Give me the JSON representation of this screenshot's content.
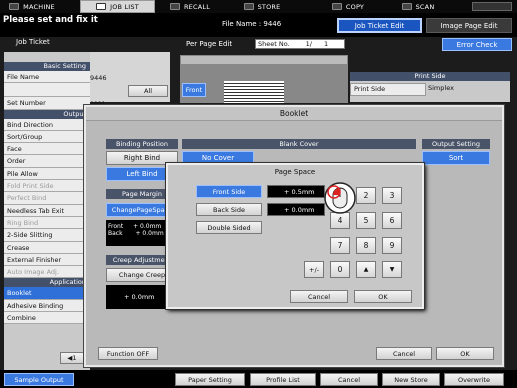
{
  "topbar": {
    "tabs": [
      {
        "label": "MACHINE",
        "active": false
      },
      {
        "label": "JOB LIST",
        "active": true
      },
      {
        "label": "RECALL",
        "active": false
      },
      {
        "label": "STORE",
        "active": false
      },
      {
        "label": "COPY",
        "active": false
      },
      {
        "label": "SCAN",
        "active": false
      }
    ]
  },
  "message": "Please set and fix it",
  "file_name_label": "File Name : 9446",
  "header_tabs": {
    "job_ticket_edit": "Job Ticket Edit",
    "image_page_edit": "Image Page Edit"
  },
  "error_check": "Error Check",
  "job_ticket": {
    "title": "Job Ticket",
    "basic_setting": "Basic Setting",
    "file_name_label": "File Name",
    "file_name_value": "9446",
    "all_button": "All",
    "set_number_label": "Set Number",
    "set_number_value": "0001",
    "output_header": "Output",
    "output_items": [
      {
        "label": "Bind Direction",
        "disabled": false
      },
      {
        "label": "Sort/Group",
        "disabled": false
      },
      {
        "label": "Face",
        "disabled": false
      },
      {
        "label": "Order",
        "disabled": false
      },
      {
        "label": "Pile Allow",
        "disabled": false
      },
      {
        "label": "Fold Print Side",
        "disabled": true
      },
      {
        "label": "Perfect Bind",
        "disabled": true
      },
      {
        "label": "Needless Tab Exit",
        "disabled": false
      },
      {
        "label": "Ring Bind",
        "disabled": true
      },
      {
        "label": "2-Side Slitting",
        "disabled": false
      },
      {
        "label": "Crease",
        "disabled": false
      },
      {
        "label": "External Finisher",
        "disabled": false
      },
      {
        "label": "Auto Image Adj.",
        "disabled": true
      }
    ],
    "application_header": "Application",
    "application_items": [
      {
        "label": "Booklet",
        "selected": true
      },
      {
        "label": "Adhesive Binding",
        "selected": false
      },
      {
        "label": "Combine",
        "selected": false
      }
    ],
    "page_counter": "1"
  },
  "per_page_edit": {
    "label": "Per Page Edit",
    "sheet_no_label": "Sheet No.",
    "sheet_no_value": "1/",
    "sheet_total": "1"
  },
  "preview": {
    "front_label": "Front"
  },
  "print_side": {
    "header": "Print Side",
    "label": "Print Side",
    "value": "Simplex"
  },
  "booklet": {
    "title": "Booklet",
    "binding_position": {
      "header": "Binding Position",
      "right_bind": "Right Bind",
      "left_bind": "Left Bind"
    },
    "blank_cover": {
      "header": "Blank Cover",
      "no_cover": "No Cover"
    },
    "output_setting": {
      "header": "Output Setting",
      "sort": "Sort"
    },
    "page_margin": {
      "header": "Page Margin",
      "change_button": "ChangePageSpace",
      "front_label": "Front",
      "front_value": "+  0.0mm",
      "back_label": "Back",
      "back_value": "+  0.0mm"
    },
    "creep": {
      "header": "Creep Adjustment",
      "change_button": "Change Creep",
      "value": "+  0.0mm"
    },
    "function_off": "Function OFF",
    "cancel": "Cancel",
    "ok": "OK"
  },
  "page_space": {
    "title": "Page Space",
    "front_side": "Front Side",
    "back_side": "Back Side",
    "double_sided": "Double Sided",
    "front_value": "+  0.5mm",
    "back_value": "+  0.0mm",
    "keypad": [
      "2",
      "3",
      "4",
      "5",
      "6",
      "7",
      "8",
      "9",
      "+/-",
      "0",
      "▲",
      "▼"
    ],
    "cancel": "Cancel",
    "ok": "OK"
  },
  "bottombar": {
    "sample_output": "Sample Output",
    "paper_setting": "Paper Setting",
    "profile_list": "Profile List",
    "cancel": "Cancel",
    "new_store": "New Store",
    "overwrite": "Overwrite"
  },
  "colors": {
    "accent_blue": "#3a7ae0",
    "selected_blue": "#1a55c0",
    "section_header": "#43506a"
  }
}
